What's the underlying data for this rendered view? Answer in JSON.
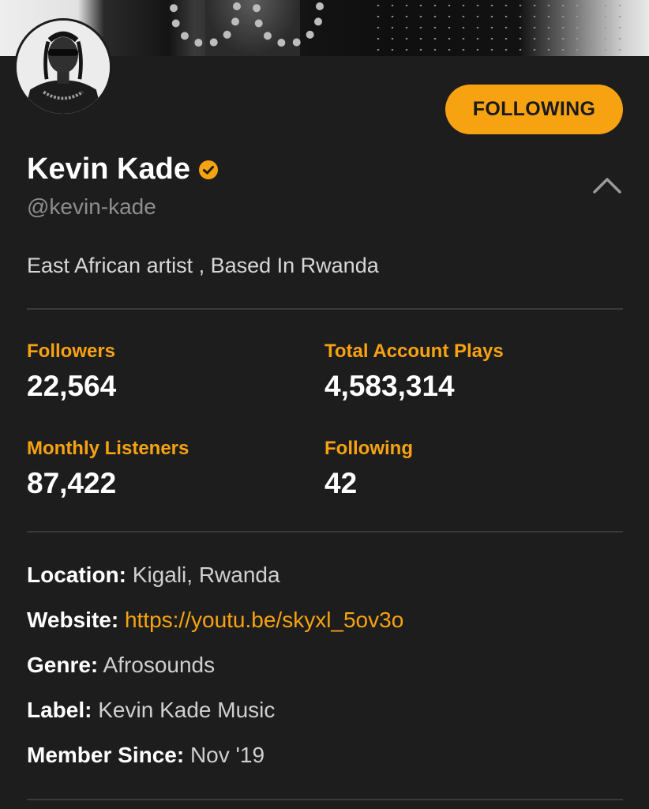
{
  "header": {
    "follow_button_label": "FOLLOWING",
    "name": "Kevin Kade",
    "handle": "@kevin-kade",
    "bio": "East African artist , Based In Rwanda"
  },
  "stats": [
    {
      "label": "Followers",
      "value": "22,564"
    },
    {
      "label": "Total Account Plays",
      "value": "4,583,314"
    },
    {
      "label": "Monthly Listeners",
      "value": "87,422"
    },
    {
      "label": "Following",
      "value": "42"
    }
  ],
  "details": {
    "location": {
      "label": "Location:",
      "value": "Kigali, Rwanda"
    },
    "website": {
      "label": "Website:",
      "value": "https://youtu.be/skyxl_5ov3o"
    },
    "genre": {
      "label": "Genre:",
      "value": "Afrosounds"
    },
    "record_label": {
      "label": "Label:",
      "value": "Kevin Kade Music"
    },
    "member_since": {
      "label": "Member Since:",
      "value": "Nov '19"
    }
  },
  "icons": {
    "verified": "verified-check-icon",
    "collapse": "chevron-up-icon"
  },
  "colors": {
    "accent": "#f7a311",
    "background": "#1d1d1d",
    "muted_text": "#8e8e8e"
  }
}
